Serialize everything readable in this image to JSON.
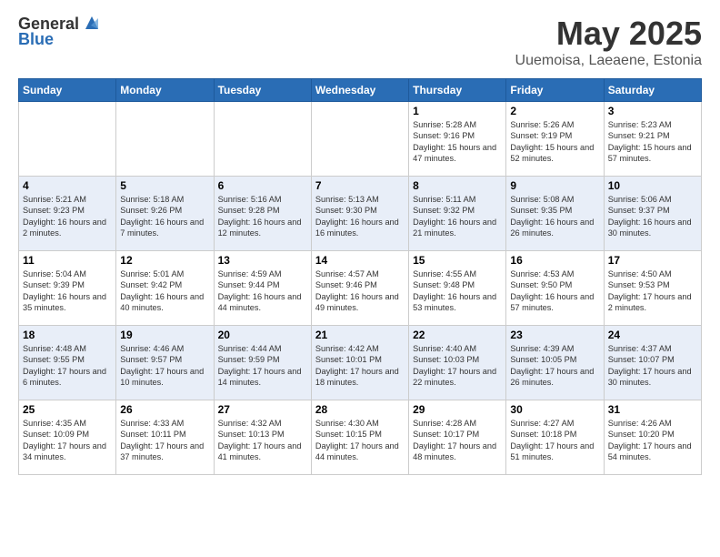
{
  "logo": {
    "general": "General",
    "blue": "Blue"
  },
  "title": {
    "month_year": "May 2025",
    "location": "Uuemoisa, Laeaene, Estonia"
  },
  "headers": [
    "Sunday",
    "Monday",
    "Tuesday",
    "Wednesday",
    "Thursday",
    "Friday",
    "Saturday"
  ],
  "weeks": [
    [
      {
        "day": "",
        "info": ""
      },
      {
        "day": "",
        "info": ""
      },
      {
        "day": "",
        "info": ""
      },
      {
        "day": "",
        "info": ""
      },
      {
        "day": "1",
        "info": "Sunrise: 5:28 AM\nSunset: 9:16 PM\nDaylight: 15 hours\nand 47 minutes."
      },
      {
        "day": "2",
        "info": "Sunrise: 5:26 AM\nSunset: 9:19 PM\nDaylight: 15 hours\nand 52 minutes."
      },
      {
        "day": "3",
        "info": "Sunrise: 5:23 AM\nSunset: 9:21 PM\nDaylight: 15 hours\nand 57 minutes."
      }
    ],
    [
      {
        "day": "4",
        "info": "Sunrise: 5:21 AM\nSunset: 9:23 PM\nDaylight: 16 hours\nand 2 minutes."
      },
      {
        "day": "5",
        "info": "Sunrise: 5:18 AM\nSunset: 9:26 PM\nDaylight: 16 hours\nand 7 minutes."
      },
      {
        "day": "6",
        "info": "Sunrise: 5:16 AM\nSunset: 9:28 PM\nDaylight: 16 hours\nand 12 minutes."
      },
      {
        "day": "7",
        "info": "Sunrise: 5:13 AM\nSunset: 9:30 PM\nDaylight: 16 hours\nand 16 minutes."
      },
      {
        "day": "8",
        "info": "Sunrise: 5:11 AM\nSunset: 9:32 PM\nDaylight: 16 hours\nand 21 minutes."
      },
      {
        "day": "9",
        "info": "Sunrise: 5:08 AM\nSunset: 9:35 PM\nDaylight: 16 hours\nand 26 minutes."
      },
      {
        "day": "10",
        "info": "Sunrise: 5:06 AM\nSunset: 9:37 PM\nDaylight: 16 hours\nand 30 minutes."
      }
    ],
    [
      {
        "day": "11",
        "info": "Sunrise: 5:04 AM\nSunset: 9:39 PM\nDaylight: 16 hours\nand 35 minutes."
      },
      {
        "day": "12",
        "info": "Sunrise: 5:01 AM\nSunset: 9:42 PM\nDaylight: 16 hours\nand 40 minutes."
      },
      {
        "day": "13",
        "info": "Sunrise: 4:59 AM\nSunset: 9:44 PM\nDaylight: 16 hours\nand 44 minutes."
      },
      {
        "day": "14",
        "info": "Sunrise: 4:57 AM\nSunset: 9:46 PM\nDaylight: 16 hours\nand 49 minutes."
      },
      {
        "day": "15",
        "info": "Sunrise: 4:55 AM\nSunset: 9:48 PM\nDaylight: 16 hours\nand 53 minutes."
      },
      {
        "day": "16",
        "info": "Sunrise: 4:53 AM\nSunset: 9:50 PM\nDaylight: 16 hours\nand 57 minutes."
      },
      {
        "day": "17",
        "info": "Sunrise: 4:50 AM\nSunset: 9:53 PM\nDaylight: 17 hours\nand 2 minutes."
      }
    ],
    [
      {
        "day": "18",
        "info": "Sunrise: 4:48 AM\nSunset: 9:55 PM\nDaylight: 17 hours\nand 6 minutes."
      },
      {
        "day": "19",
        "info": "Sunrise: 4:46 AM\nSunset: 9:57 PM\nDaylight: 17 hours\nand 10 minutes."
      },
      {
        "day": "20",
        "info": "Sunrise: 4:44 AM\nSunset: 9:59 PM\nDaylight: 17 hours\nand 14 minutes."
      },
      {
        "day": "21",
        "info": "Sunrise: 4:42 AM\nSunset: 10:01 PM\nDaylight: 17 hours\nand 18 minutes."
      },
      {
        "day": "22",
        "info": "Sunrise: 4:40 AM\nSunset: 10:03 PM\nDaylight: 17 hours\nand 22 minutes."
      },
      {
        "day": "23",
        "info": "Sunrise: 4:39 AM\nSunset: 10:05 PM\nDaylight: 17 hours\nand 26 minutes."
      },
      {
        "day": "24",
        "info": "Sunrise: 4:37 AM\nSunset: 10:07 PM\nDaylight: 17 hours\nand 30 minutes."
      }
    ],
    [
      {
        "day": "25",
        "info": "Sunrise: 4:35 AM\nSunset: 10:09 PM\nDaylight: 17 hours\nand 34 minutes."
      },
      {
        "day": "26",
        "info": "Sunrise: 4:33 AM\nSunset: 10:11 PM\nDaylight: 17 hours\nand 37 minutes."
      },
      {
        "day": "27",
        "info": "Sunrise: 4:32 AM\nSunset: 10:13 PM\nDaylight: 17 hours\nand 41 minutes."
      },
      {
        "day": "28",
        "info": "Sunrise: 4:30 AM\nSunset: 10:15 PM\nDaylight: 17 hours\nand 44 minutes."
      },
      {
        "day": "29",
        "info": "Sunrise: 4:28 AM\nSunset: 10:17 PM\nDaylight: 17 hours\nand 48 minutes."
      },
      {
        "day": "30",
        "info": "Sunrise: 4:27 AM\nSunset: 10:18 PM\nDaylight: 17 hours\nand 51 minutes."
      },
      {
        "day": "31",
        "info": "Sunrise: 4:26 AM\nSunset: 10:20 PM\nDaylight: 17 hours\nand 54 minutes."
      }
    ]
  ]
}
